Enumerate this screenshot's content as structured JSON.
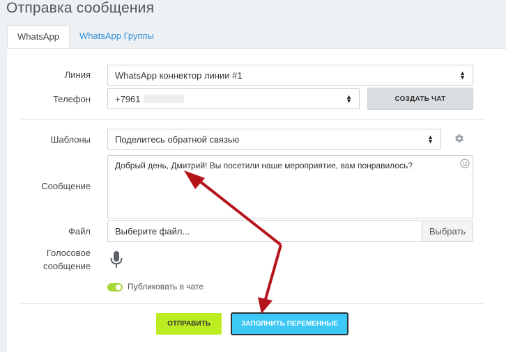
{
  "page": {
    "title": "Отправка сообщения"
  },
  "tabs": [
    {
      "label": "WhatsApp",
      "active": true
    },
    {
      "label": "WhatsApp Группы",
      "active": false
    }
  ],
  "form": {
    "line": {
      "label": "Линия",
      "value": "WhatsApp коннектор линии #1"
    },
    "phone": {
      "label": "Телефон",
      "value": "+7961"
    },
    "create_chat_label": "СОЗДАТЬ ЧАТ",
    "templates": {
      "label": "Шаблоны",
      "value": "Поделитесь обратной связью"
    },
    "message": {
      "label": "Сообщение",
      "value": "Добрый день, Дмитрий! Вы посетили наше мероприятие, вам понравилось?"
    },
    "file": {
      "label": "Файл",
      "placeholder": "Выберите файл...",
      "button_label": "Выбрать"
    },
    "voice": {
      "label_line1": "Голосовое",
      "label_line2": "сообщение"
    },
    "publish": {
      "label": "Публиковать в чате",
      "enabled": true
    }
  },
  "actions": {
    "send_label": "ОТПРАВИТЬ",
    "fill_variables_label": "ЗАПОЛНИТЬ ПЕРЕМЕННЫЕ"
  },
  "colors": {
    "send_button": "#bbed21",
    "fill_button": "#3bc8f5",
    "toggle": "#a7d836",
    "tab_link": "#2f8fd8",
    "annotation_arrow": "#b5141b"
  },
  "icons": {
    "settings": "gear-icon",
    "emoji": "smiley-icon",
    "voice": "microphone-icon",
    "select": "select-arrows-icon"
  }
}
